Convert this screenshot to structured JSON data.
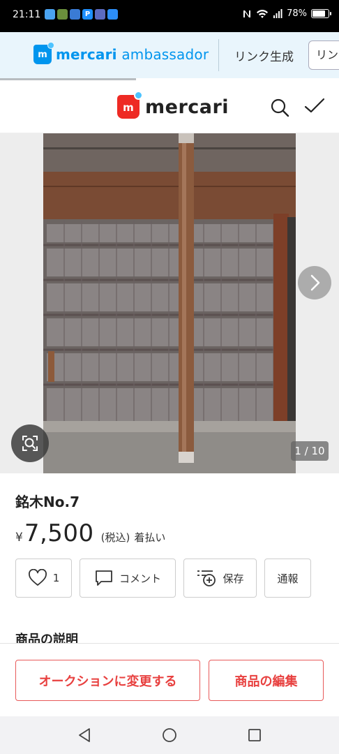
{
  "status_bar": {
    "time": "21:11",
    "battery": "78%"
  },
  "ambassador_bar": {
    "brand_bold": "mercari",
    "brand_light": "ambassador",
    "link_generate": "リンク生成",
    "link_button": "リンク"
  },
  "header": {
    "logo_text": "mercari"
  },
  "gallery": {
    "counter": "1 / 10"
  },
  "item": {
    "title": "銘木No.7",
    "currency": "¥",
    "price": "7,500",
    "tax_label": "(税込)",
    "shipping": "着払い"
  },
  "actions": {
    "like_count": "1",
    "comment_label": "コメント",
    "save_label": "保存",
    "report_label": "通報"
  },
  "description": {
    "heading": "商品の説明"
  },
  "bottom_actions": {
    "auction_label": "オークションに変更する",
    "edit_label": "商品の編集"
  },
  "colors": {
    "accent_red": "#e8403f",
    "mercari_red": "#ee2a24",
    "ambassador_blue": "#0095ee"
  }
}
